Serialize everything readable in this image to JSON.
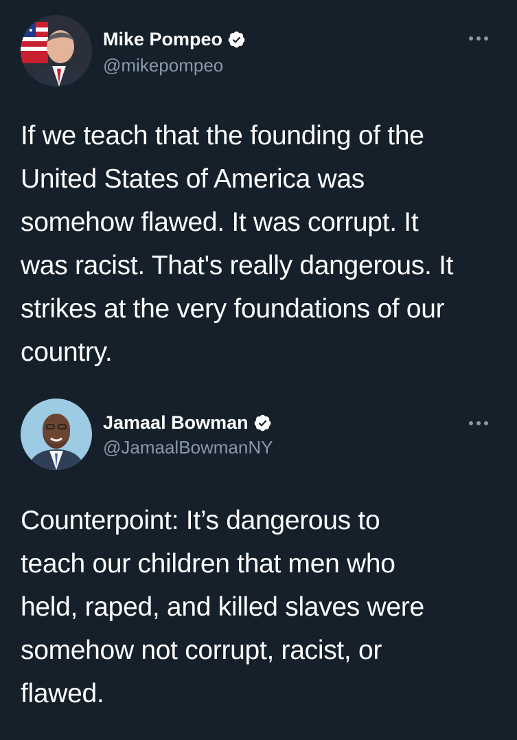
{
  "theme": {
    "background": "#15202b",
    "primary_text": "#ffffff",
    "secondary_text": "#8899a6",
    "verified_color": "#ffffff"
  },
  "tweets": [
    {
      "display_name": "Mike Pompeo",
      "handle": "@mikepompeo",
      "verified": true,
      "avatar_icon": "profile-photo",
      "more_icon": "more-options-icon",
      "text": "If we teach that the founding of the\nUnited States of America was\nsomehow flawed. It was corrupt. It\nwas racist. That's really dangerous. It\nstrikes at the very foundations of our\ncountry."
    },
    {
      "display_name": "Jamaal Bowman",
      "handle": "@JamaalBowmanNY",
      "verified": true,
      "avatar_icon": "profile-photo",
      "more_icon": "more-options-icon",
      "text": "Counterpoint: It’s dangerous to\nteach our children that men who\nheld, raped, and killed slaves were\nsomehow not corrupt, racist, or\nflawed."
    }
  ]
}
